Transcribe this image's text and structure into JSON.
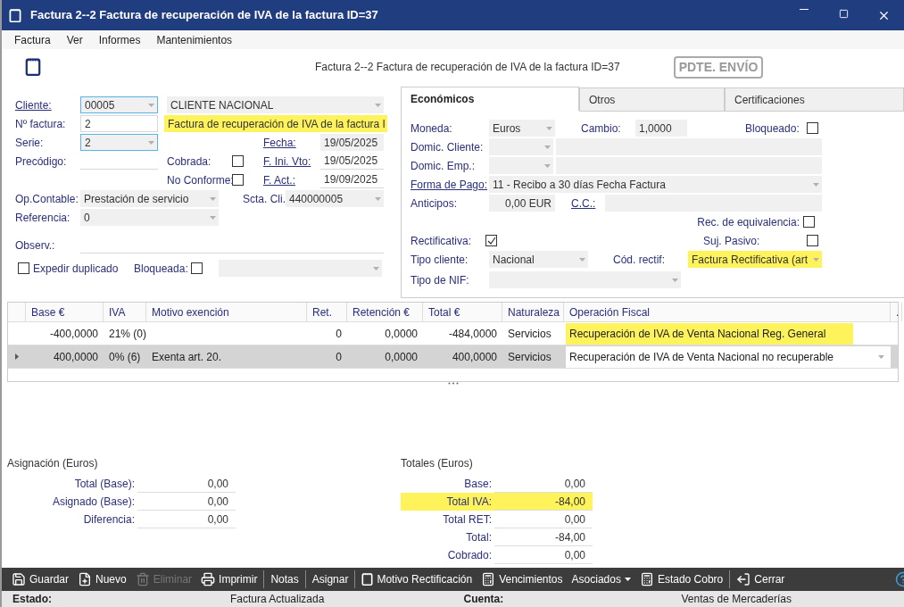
{
  "window": {
    "title": "Factura 2--2 Factura de recuperación de IVA de la factura ID=37"
  },
  "menu": [
    "Factura",
    "Ver",
    "Informes",
    "Mantenimientos"
  ],
  "header": {
    "title": "Factura 2--2 Factura de recuperación de IVA de la factura ID=37",
    "stamp": "PDTE. ENVÍO"
  },
  "general": {
    "cliente": {
      "label": "Cliente:",
      "code": "00005",
      "name": "CLIENTE NACIONAL"
    },
    "numero": {
      "label": "Nº factura:",
      "value": "2"
    },
    "descripcion": {
      "value": "Factura de recuperación de IVA de la factura I",
      "highlighted": true
    },
    "serie": {
      "label": "Serie:",
      "value": "2"
    },
    "fecha": {
      "label": "Fecha:",
      "value": "19/05/2025"
    },
    "precodigo": {
      "label": "Precódigo:"
    },
    "cobrada": {
      "label": "Cobrada:",
      "checked": false
    },
    "f_ini_vto": {
      "label": "F. Ini. Vto:",
      "value": "19/05/2025"
    },
    "no_conforme": {
      "label": "No Conforme:",
      "checked": false
    },
    "f_act": {
      "label": "F. Act.:",
      "value": "19/09/2025"
    },
    "op_contable": {
      "label": "Op.Contable:",
      "value": "Prestación de servicio"
    },
    "scta_cli": {
      "label": "Scta. Cli.",
      "value": "440000005"
    },
    "referencia": {
      "label": "Referencia:",
      "value": "0"
    },
    "observ": {
      "label": "Observ.:"
    },
    "expedir_duplicado": {
      "label": "Expedir duplicado",
      "checked": false
    },
    "bloqueada": {
      "label": "Bloqueada:",
      "checked": false
    }
  },
  "tabs": [
    {
      "label": "Económicos",
      "selected": true
    },
    {
      "label": "Otros",
      "selected": false
    },
    {
      "label": "Certificaciones",
      "selected": false
    }
  ],
  "economicos": {
    "moneda": {
      "label": "Moneda:",
      "value": "Euros"
    },
    "cambio": {
      "label": "Cambio:",
      "value": "1,0000"
    },
    "bloqueado": {
      "label": "Bloqueado:",
      "checked": false
    },
    "domic_cliente": {
      "label": "Domic. Cliente:"
    },
    "domic_emp": {
      "label": "Domic. Emp.:"
    },
    "forma_pago": {
      "label": "Forma de Pago:",
      "value": "11 - Recibo a 30 días Fecha Factura"
    },
    "anticipos": {
      "label": "Anticipos:",
      "value": "0,00 EUR"
    },
    "cc": {
      "label": "C.C.:"
    },
    "rec_equivalencia": {
      "label": "Rec. de equivalencia:",
      "checked": false
    },
    "rectificativa": {
      "label": "Rectificativa:",
      "checked": true
    },
    "suj_pasivo": {
      "label": "Suj. Pasivo:",
      "checked": false
    },
    "tipo_cliente": {
      "label": "Tipo cliente:",
      "value": "Nacional"
    },
    "cod_rectif": {
      "label": "Cód. rectif:",
      "value": "Factura Rectificativa (art",
      "highlighted": true
    },
    "tipo_nif": {
      "label": "Tipo de NIF:"
    }
  },
  "lines": {
    "columns": [
      "Base €",
      "IVA",
      "Motivo exención",
      "Ret.",
      "Retención €",
      "Total €",
      "Naturaleza",
      "Operación Fiscal",
      "."
    ],
    "rows": [
      {
        "selected": false,
        "kind": "text",
        "highlighted": true,
        "cells": [
          "-400,0000",
          "21% (0)",
          "",
          "0",
          "0,0000",
          "-484,0000",
          "Servicios",
          "Recuperación de IVA de Venta Nacional Reg. General"
        ]
      },
      {
        "selected": true,
        "kind": "dropdown",
        "highlighted": false,
        "cells": [
          "400,0000",
          "0% (6)",
          "Exenta art. 20.",
          "0",
          "0,0000",
          "400,0000",
          "Servicios",
          "Recuperación de IVA de Venta Nacional no recuperable"
        ]
      }
    ]
  },
  "asignacion": {
    "title": "Asignación (Euros)",
    "rows": [
      {
        "label": "Total (Base):",
        "value": "0,00",
        "highlighted": false
      },
      {
        "label": "Asignado (Base):",
        "value": "0,00",
        "highlighted": false
      },
      {
        "label": "Diferencia:",
        "value": "0,00",
        "highlighted": false
      }
    ]
  },
  "totales": {
    "title": "Totales (Euros)",
    "rows": [
      {
        "label": "Base:",
        "value": "0,00",
        "highlighted": false
      },
      {
        "label": "Total IVA:",
        "value": "-84,00",
        "highlighted": true
      },
      {
        "label": "Total RET:",
        "value": "0,00",
        "highlighted": false
      },
      {
        "label": "Total:",
        "value": "-84,00",
        "highlighted": false
      },
      {
        "label": "Cobrado:",
        "value": "0,00",
        "highlighted": false
      }
    ]
  },
  "toolbar": [
    {
      "label": "Guardar",
      "kind": "button",
      "disabled": false
    },
    {
      "label": "Nuevo",
      "kind": "button",
      "disabled": false
    },
    {
      "label": "Eliminar",
      "kind": "button",
      "disabled": true
    },
    {
      "label": "Imprimir",
      "kind": "button",
      "disabled": false
    },
    {
      "label": "Notas",
      "kind": "button",
      "disabled": false
    },
    {
      "label": "Asignar",
      "kind": "button",
      "disabled": false
    },
    {
      "label": "Motivo Rectificación",
      "kind": "button",
      "disabled": false
    },
    {
      "label": "Vencimientos",
      "kind": "button",
      "disabled": false
    },
    {
      "label": "Asociados",
      "kind": "menu",
      "disabled": false
    },
    {
      "label": "Estado Cobro",
      "kind": "button",
      "disabled": false
    },
    {
      "label": "Cerrar",
      "kind": "button",
      "disabled": false
    }
  ],
  "status_bar": [
    {
      "label": "Estado:",
      "value": "Factura Actualizada"
    },
    {
      "label": "Cuenta:",
      "value": "Ventas de Mercaderías"
    }
  ]
}
